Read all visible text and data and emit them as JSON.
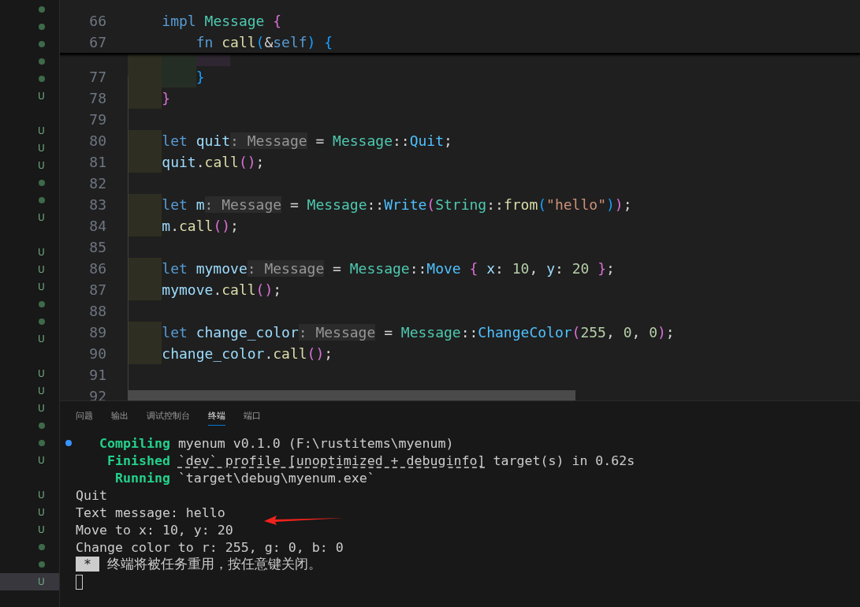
{
  "gutter": {
    "markers": [
      {
        "kind": "dot",
        "selected": false
      },
      {
        "kind": "dot",
        "selected": false
      },
      {
        "kind": "dot",
        "selected": false
      },
      {
        "kind": "dot",
        "selected": false
      },
      {
        "kind": "dot",
        "selected": false
      },
      {
        "kind": "letter",
        "text": "U",
        "selected": false
      },
      {
        "kind": "blank",
        "selected": false
      },
      {
        "kind": "letter",
        "text": "U",
        "selected": false
      },
      {
        "kind": "letter",
        "text": "U",
        "selected": false
      },
      {
        "kind": "letter",
        "text": "U",
        "selected": false
      },
      {
        "kind": "dot",
        "selected": false
      },
      {
        "kind": "dot",
        "selected": false
      },
      {
        "kind": "letter",
        "text": "U",
        "selected": false
      },
      {
        "kind": "blank",
        "selected": false
      },
      {
        "kind": "letter",
        "text": "U",
        "selected": false
      },
      {
        "kind": "letter",
        "text": "U",
        "selected": false
      },
      {
        "kind": "letter",
        "text": "U",
        "selected": false
      },
      {
        "kind": "dot",
        "selected": false
      },
      {
        "kind": "dot",
        "selected": false
      },
      {
        "kind": "letter",
        "text": "U",
        "selected": false
      },
      {
        "kind": "blank",
        "selected": false
      },
      {
        "kind": "letter",
        "text": "U",
        "selected": false
      },
      {
        "kind": "letter",
        "text": "U",
        "selected": false
      },
      {
        "kind": "letter",
        "text": "U",
        "selected": false
      },
      {
        "kind": "dot",
        "selected": false
      },
      {
        "kind": "dot",
        "selected": false
      },
      {
        "kind": "letter",
        "text": "U",
        "selected": false
      },
      {
        "kind": "blank",
        "selected": false
      },
      {
        "kind": "letter",
        "text": "U",
        "selected": false
      },
      {
        "kind": "letter",
        "text": "U",
        "selected": false
      },
      {
        "kind": "letter",
        "text": "U",
        "selected": false
      },
      {
        "kind": "dot",
        "selected": false
      },
      {
        "kind": "dot",
        "selected": false
      },
      {
        "kind": "letter",
        "text": "U",
        "selected": true
      }
    ]
  },
  "editor": {
    "sticky_lines": [
      {
        "number": "66",
        "tokens": [
          {
            "kind": "kw",
            "text": "    impl"
          },
          {
            "kind": "type",
            "text": " Message"
          },
          {
            "kind": "b2",
            "text": " {"
          }
        ]
      },
      {
        "number": "67",
        "tokens": [
          {
            "kind": "kw",
            "text": "        fn"
          },
          {
            "kind": "fn",
            "text": " call"
          },
          {
            "kind": "b3",
            "text": "("
          },
          {
            "kind": "plain",
            "text": "&"
          },
          {
            "kind": "kw",
            "text": "self"
          },
          {
            "kind": "b3",
            "text": ")"
          },
          {
            "kind": "b3",
            "text": " {"
          }
        ]
      }
    ],
    "lines": [
      {
        "guides": [
          {
            "color": "#2f2e22"
          },
          {
            "color": "#252e25"
          },
          {
            "color": "#2e2630"
          }
        ]
      },
      {
        "number": "77",
        "guides": [
          {
            "color": "#2f2e22"
          },
          {
            "color": "#252e25"
          }
        ],
        "tokens": [
          {
            "kind": "b3",
            "text": "}"
          }
        ]
      },
      {
        "number": "78",
        "guides": [
          {
            "color": "#2f2e22"
          }
        ],
        "tokens": [
          {
            "kind": "b2",
            "text": "}"
          }
        ]
      },
      {
        "number": "79"
      },
      {
        "number": "80",
        "guides": [
          {
            "color": "#2f2e22"
          }
        ],
        "tokens": [
          {
            "kind": "kw",
            "text": "let"
          },
          {
            "kind": "var",
            "text": " quit"
          },
          {
            "kind": "hint",
            "text": ": Message"
          },
          {
            "kind": "plain",
            "text": " = "
          },
          {
            "kind": "type",
            "text": "Message"
          },
          {
            "kind": "plain",
            "text": "::"
          },
          {
            "kind": "variant",
            "text": "Quit"
          },
          {
            "kind": "plain",
            "text": ";"
          }
        ]
      },
      {
        "number": "81",
        "guides": [
          {
            "color": "#2f2e22"
          }
        ],
        "tokens": [
          {
            "kind": "var",
            "text": "quit"
          },
          {
            "kind": "plain",
            "text": "."
          },
          {
            "kind": "fn",
            "text": "call"
          },
          {
            "kind": "b2",
            "text": "()"
          },
          {
            "kind": "plain",
            "text": ";"
          }
        ]
      },
      {
        "number": "82"
      },
      {
        "number": "83",
        "guides": [
          {
            "color": "#2f2e22"
          }
        ],
        "tokens": [
          {
            "kind": "kw",
            "text": "let"
          },
          {
            "kind": "var",
            "text": " m"
          },
          {
            "kind": "hint",
            "text": ": Message"
          },
          {
            "kind": "plain",
            "text": " = "
          },
          {
            "kind": "type",
            "text": "Message"
          },
          {
            "kind": "plain",
            "text": "::"
          },
          {
            "kind": "variant",
            "text": "Write"
          },
          {
            "kind": "b2",
            "text": "("
          },
          {
            "kind": "type",
            "text": "String"
          },
          {
            "kind": "plain",
            "text": "::"
          },
          {
            "kind": "fn",
            "text": "from"
          },
          {
            "kind": "b3",
            "text": "("
          },
          {
            "kind": "str",
            "text": "\"hello\""
          },
          {
            "kind": "b3",
            "text": ")"
          },
          {
            "kind": "b2",
            "text": ")"
          },
          {
            "kind": "plain",
            "text": ";"
          }
        ]
      },
      {
        "number": "84",
        "guides": [
          {
            "color": "#2f2e22"
          }
        ],
        "tokens": [
          {
            "kind": "var",
            "text": "m"
          },
          {
            "kind": "plain",
            "text": "."
          },
          {
            "kind": "fn",
            "text": "call"
          },
          {
            "kind": "b2",
            "text": "()"
          },
          {
            "kind": "plain",
            "text": ";"
          }
        ]
      },
      {
        "number": "85"
      },
      {
        "number": "86",
        "guides": [
          {
            "color": "#2f2e22"
          }
        ],
        "tokens": [
          {
            "kind": "kw",
            "text": "let"
          },
          {
            "kind": "var",
            "text": " mymove"
          },
          {
            "kind": "hint",
            "text": ": Message"
          },
          {
            "kind": "plain",
            "text": " = "
          },
          {
            "kind": "type",
            "text": "Message"
          },
          {
            "kind": "plain",
            "text": "::"
          },
          {
            "kind": "variant",
            "text": "Move"
          },
          {
            "kind": "b2",
            "text": " {"
          },
          {
            "kind": "var",
            "text": " x"
          },
          {
            "kind": "plain",
            "text": ": "
          },
          {
            "kind": "num",
            "text": "10"
          },
          {
            "kind": "plain",
            "text": ", "
          },
          {
            "kind": "var",
            "text": "y"
          },
          {
            "kind": "plain",
            "text": ": "
          },
          {
            "kind": "num",
            "text": "20"
          },
          {
            "kind": "b2",
            "text": " }"
          },
          {
            "kind": "plain",
            "text": ";"
          }
        ]
      },
      {
        "number": "87",
        "guides": [
          {
            "color": "#2f2e22"
          }
        ],
        "tokens": [
          {
            "kind": "var",
            "text": "mymove"
          },
          {
            "kind": "plain",
            "text": "."
          },
          {
            "kind": "fn",
            "text": "call"
          },
          {
            "kind": "b2",
            "text": "()"
          },
          {
            "kind": "plain",
            "text": ";"
          }
        ]
      },
      {
        "number": "88"
      },
      {
        "number": "89",
        "guides": [
          {
            "color": "#2f2e22"
          }
        ],
        "tokens": [
          {
            "kind": "kw",
            "text": "let"
          },
          {
            "kind": "var",
            "text": " change_color"
          },
          {
            "kind": "hint",
            "text": ": Message"
          },
          {
            "kind": "plain",
            "text": " = "
          },
          {
            "kind": "type",
            "text": "Message"
          },
          {
            "kind": "plain",
            "text": "::"
          },
          {
            "kind": "variant",
            "text": "ChangeColor"
          },
          {
            "kind": "b2",
            "text": "("
          },
          {
            "kind": "num",
            "text": "255"
          },
          {
            "kind": "plain",
            "text": ", "
          },
          {
            "kind": "num",
            "text": "0"
          },
          {
            "kind": "plain",
            "text": ", "
          },
          {
            "kind": "num",
            "text": "0"
          },
          {
            "kind": "b2",
            "text": ")"
          },
          {
            "kind": "plain",
            "text": ";"
          }
        ]
      },
      {
        "number": "90",
        "guides": [
          {
            "color": "#2f2e22"
          }
        ],
        "tokens": [
          {
            "kind": "var",
            "text": "change_color"
          },
          {
            "kind": "plain",
            "text": "."
          },
          {
            "kind": "fn",
            "text": "call"
          },
          {
            "kind": "b2",
            "text": "()"
          },
          {
            "kind": "plain",
            "text": ";"
          }
        ]
      },
      {
        "number": "91"
      },
      {
        "number": "92"
      }
    ]
  },
  "panel": {
    "tabs": [
      {
        "label": "问题",
        "selected": false
      },
      {
        "label": "输出",
        "selected": false
      },
      {
        "label": "调试控制台",
        "selected": false
      },
      {
        "label": "终端",
        "selected": true
      },
      {
        "label": "端口",
        "selected": false
      }
    ],
    "terminal": {
      "cursor": true,
      "lines": [
        {
          "marker": true,
          "tokens": [
            {
              "kind": "status",
              "text": "   Compiling"
            },
            {
              "kind": "plain",
              "text": " myenum v0.1.0 (F:\\rustitems\\myenum)"
            }
          ]
        },
        {
          "marker": false,
          "tokens": [
            {
              "kind": "status",
              "text": "    Finished "
            },
            {
              "kind": "link",
              "text": "`dev` profile [unoptimized + debuginfo]"
            },
            {
              "kind": "plain",
              "text": " target(s) in 0.62s"
            }
          ]
        },
        {
          "marker": false,
          "tokens": [
            {
              "kind": "status",
              "text": "     Running"
            },
            {
              "kind": "plain",
              "text": " `target\\debug\\myenum.exe`"
            }
          ]
        },
        {
          "marker": false,
          "tokens": [
            {
              "kind": "plain",
              "text": "Quit"
            }
          ]
        },
        {
          "marker": false,
          "tokens": [
            {
              "kind": "plain",
              "text": "Text message: hello"
            }
          ]
        },
        {
          "marker": false,
          "tokens": [
            {
              "kind": "plain",
              "text": "Move to x: 10, y: 20"
            }
          ]
        },
        {
          "marker": false,
          "tokens": [
            {
              "kind": "plain",
              "text": "Change color to r: 255, g: 0, b: 0"
            }
          ]
        },
        {
          "marker": false,
          "tokens": [
            {
              "kind": "inverse",
              "text": " * "
            },
            {
              "kind": "plain",
              "text": " 终端将被任务重用，按任意键关闭。"
            }
          ]
        }
      ]
    }
  },
  "annotations": [
    {
      "kind": "arrow"
    }
  ]
}
